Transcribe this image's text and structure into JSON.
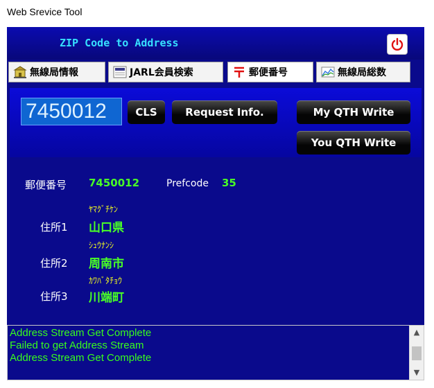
{
  "window": {
    "title": "Web Srevice Tool"
  },
  "header": {
    "title": "ZIP Code to Address"
  },
  "tabs": [
    {
      "label": "無線局情報",
      "icon": "building-icon"
    },
    {
      "label": "JARL会員検索",
      "icon": "jarl-icon"
    },
    {
      "label": "郵便番号",
      "icon": "postal-mark-icon"
    },
    {
      "label": "無線局総数",
      "icon": "chart-icon"
    }
  ],
  "search": {
    "zip_value": "7450012",
    "cls_label": "CLS",
    "request_label": "Request Info.",
    "my_qth_label": "My QTH Write",
    "you_qth_label": "You QTH Write"
  },
  "info": {
    "postal_label": "郵便番号",
    "postal_value": "7450012",
    "prefcode_label": "Prefcode",
    "prefcode_value": "35",
    "addr1_label": "住所1",
    "addr1_kana": "ﾔﾏｸﾞﾁｹﾝ",
    "addr1_value": "山口県",
    "addr2_label": "住所2",
    "addr2_kana": "ｼｭｳﾅﾝｼ",
    "addr2_value": "周南市",
    "addr3_label": "住所3",
    "addr3_kana": "ｶﾜﾊﾞﾀﾁｮｳ",
    "addr3_value": "川端町"
  },
  "log": {
    "lines": [
      "Address Stream Get Complete",
      "Failed to get Address Stream",
      "Address Stream Get Complete"
    ]
  },
  "colors": {
    "background": "#0a0a8c",
    "accent_text": "#49ff26",
    "kana_text": "#f6ff1e",
    "header_text": "#36e0ff",
    "power_icon": "#e01010"
  }
}
